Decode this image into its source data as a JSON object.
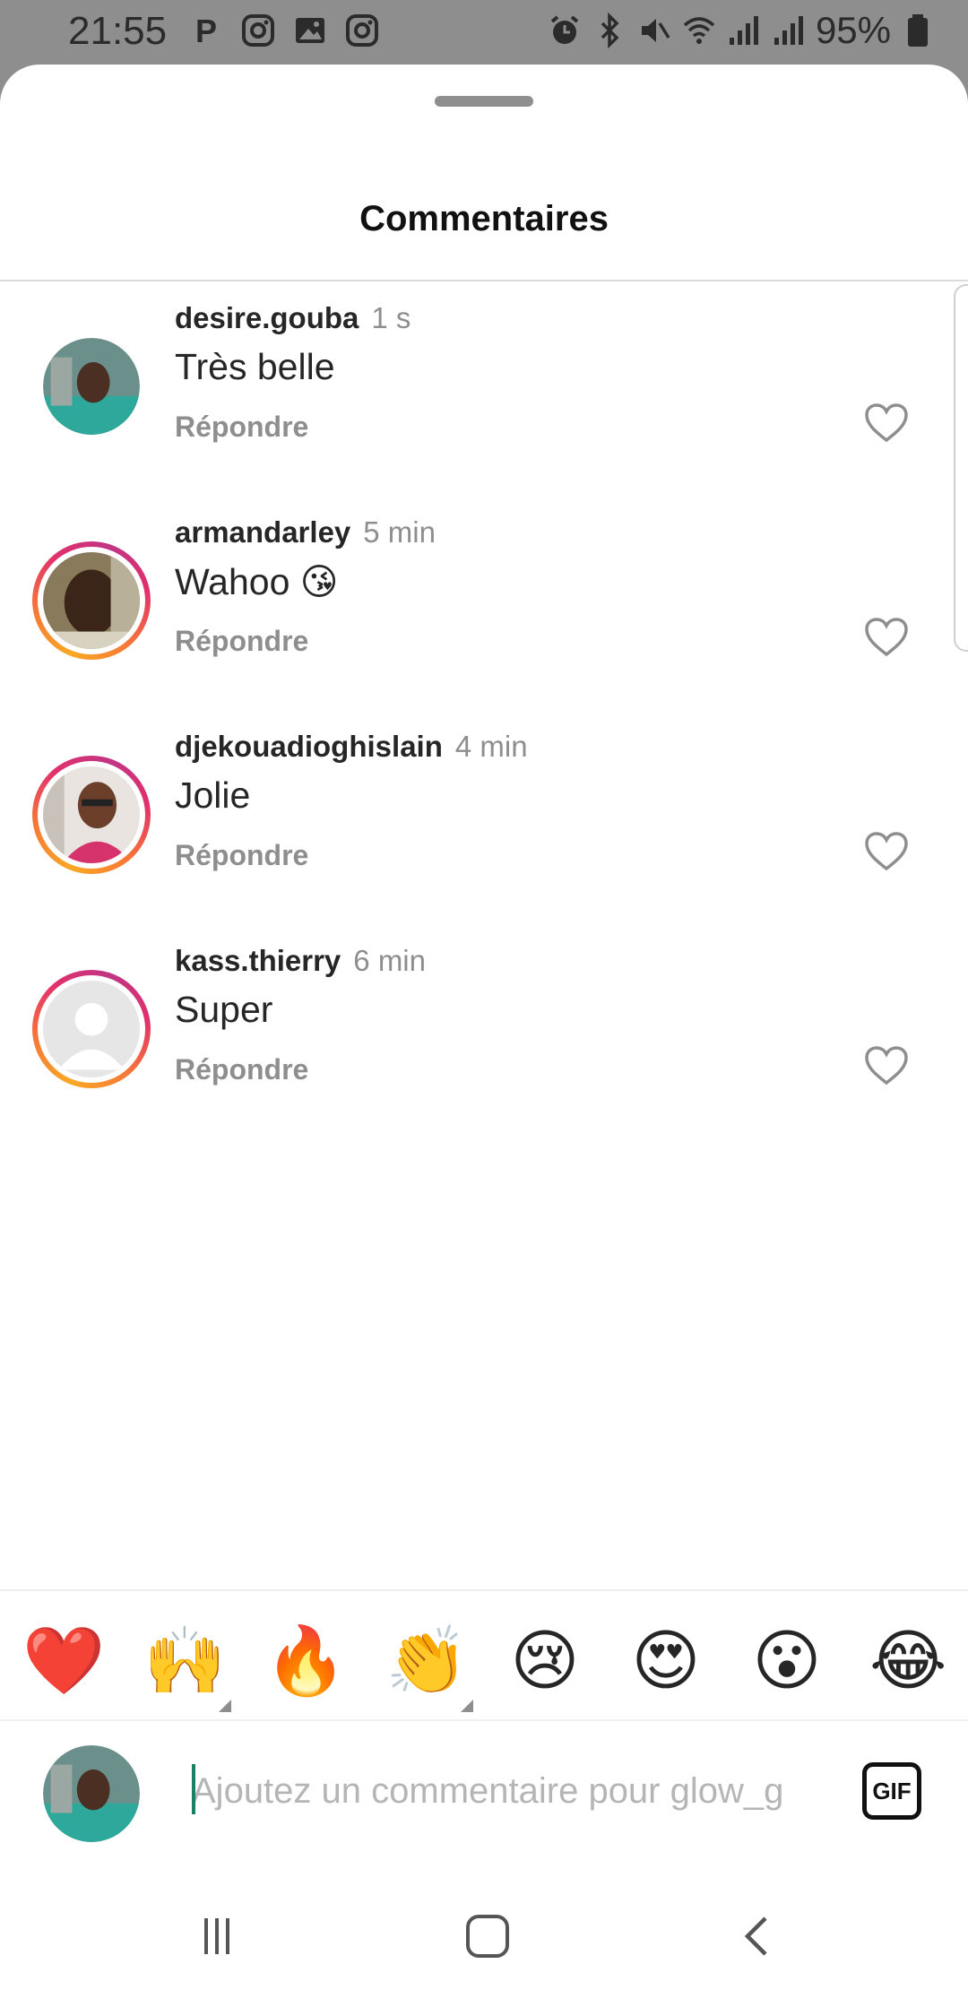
{
  "status_bar": {
    "time": "21:55",
    "left_icons": [
      "parking-icon",
      "instagram-icon",
      "gallery-icon",
      "instagram-icon"
    ],
    "right_icons": [
      "alarm-icon",
      "bluetooth-icon",
      "mute-icon",
      "wifi-icon",
      "signal-icon",
      "signal-icon"
    ],
    "battery": "95%"
  },
  "sheet": {
    "title": "Commentaires"
  },
  "comments": [
    {
      "username": "desire.gouba",
      "time": "1 s",
      "text": "Très belle",
      "reply": "Répondre",
      "story_ring": false
    },
    {
      "username": "armandarley",
      "time": "5 min",
      "text": "Wahoo 😘",
      "reply": "Répondre",
      "story_ring": true
    },
    {
      "username": "djekouadioghislain",
      "time": "4 min",
      "text": "Jolie",
      "reply": "Répondre",
      "story_ring": true
    },
    {
      "username": "kass.thierry",
      "time": "6 min",
      "text": "Super",
      "reply": "Répondre",
      "story_ring": true
    }
  ],
  "emoji_bar": [
    "❤️",
    "🙌",
    "🔥",
    "👏",
    "😢",
    "😍",
    "😮",
    "😂"
  ],
  "composer": {
    "placeholder": "Ajoutez un commentaire pour glow_g",
    "value": "",
    "gif_label": "GIF"
  },
  "nav_bar": {
    "icons": [
      "recent-apps-icon",
      "home-icon",
      "back-icon"
    ]
  },
  "colors": {
    "ring_gradient": [
      "#f9a825",
      "#e1306c",
      "#c13584"
    ],
    "caret": "#1a7f64"
  }
}
